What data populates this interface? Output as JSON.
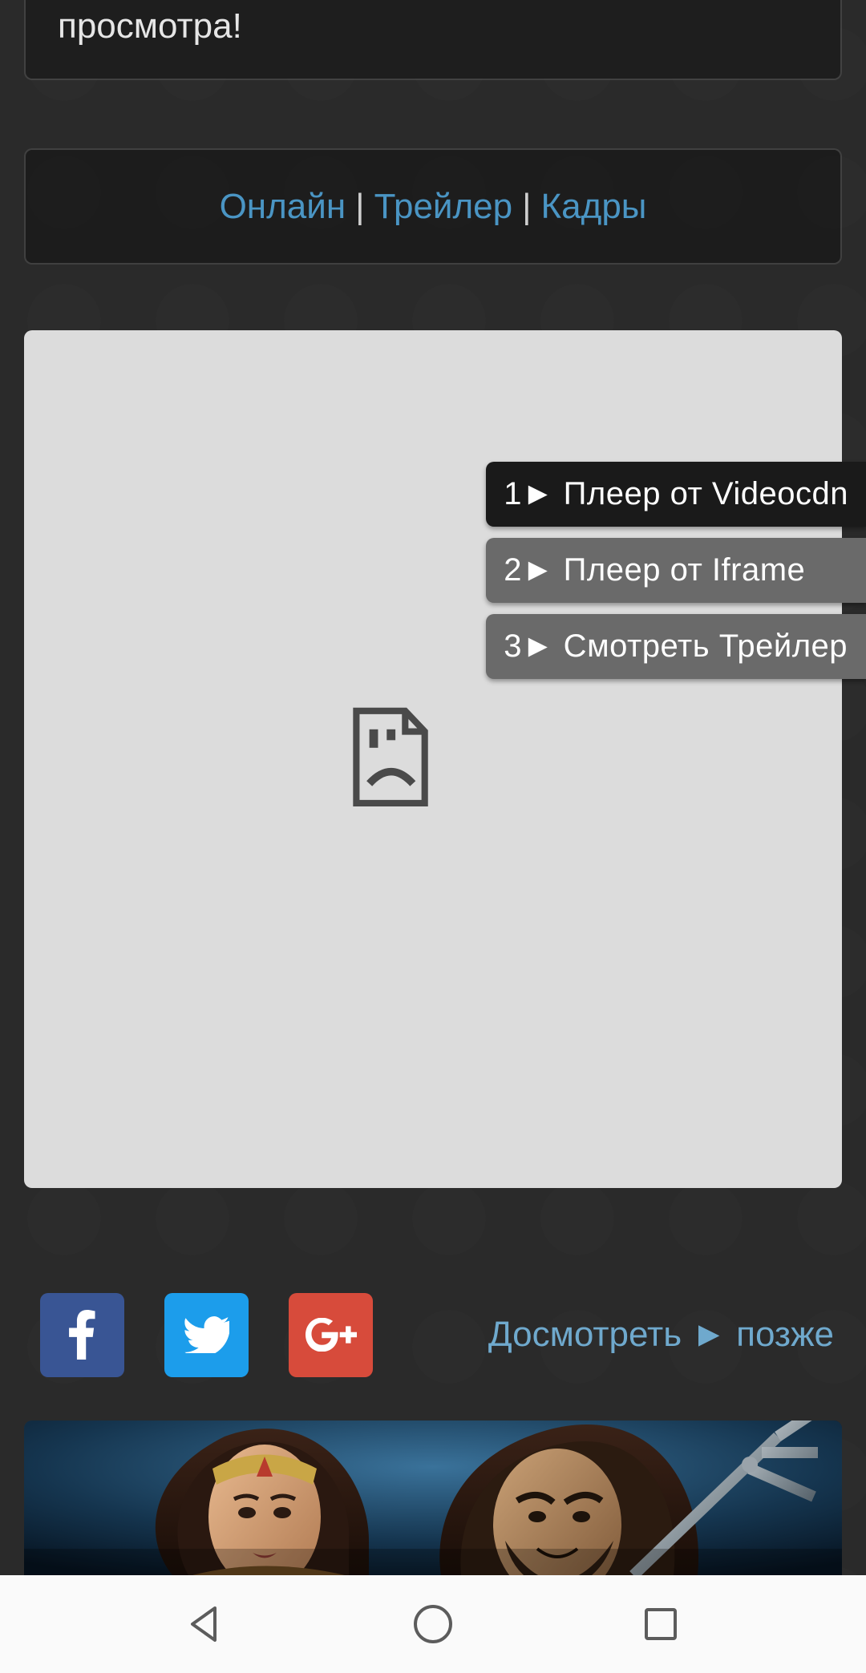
{
  "topCard": {
    "visibleText": "просмотра!"
  },
  "tabs": {
    "online": "Онлайн",
    "trailer": "Трейлер",
    "frames": "Кадры",
    "separator": "|"
  },
  "playerButtons": [
    {
      "label": "1► Плеер от Videocdn",
      "active": true
    },
    {
      "label": "2► Плеер от Iframe",
      "active": false
    },
    {
      "label": "3► Смотреть Трейлер",
      "active": false
    }
  ],
  "watchLater": "Досмотреть ► позже",
  "icons": {
    "facebook": "facebook-icon",
    "twitter": "twitter-icon",
    "googleplus": "googleplus-icon",
    "broken": "broken-file-icon"
  }
}
